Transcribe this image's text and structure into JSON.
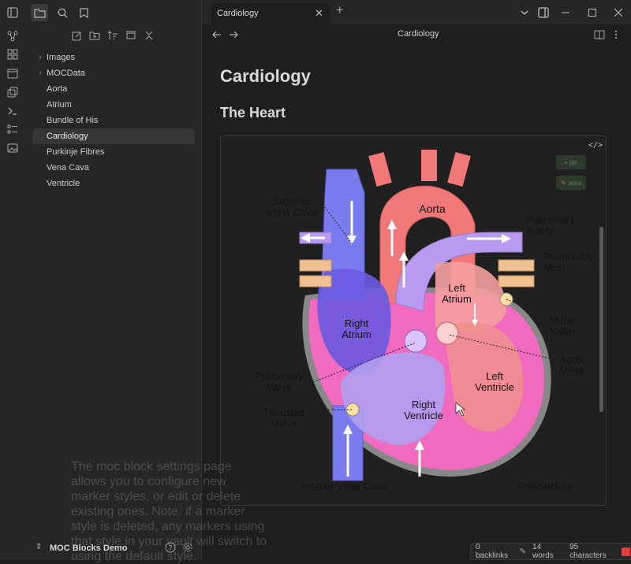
{
  "tab": {
    "title": "Cardiology"
  },
  "view_header": {
    "title": "Cardiology"
  },
  "sidebar": {
    "files": [
      {
        "label": "Images",
        "folder": true
      },
      {
        "label": "MOCData",
        "folder": true
      },
      {
        "label": "Aorta"
      },
      {
        "label": "Atrium"
      },
      {
        "label": "Bundle of His"
      },
      {
        "label": "Cardiology",
        "active": true
      },
      {
        "label": "Purkinje Fibres"
      },
      {
        "label": "Vena Cava"
      },
      {
        "label": "Ventricle"
      }
    ],
    "vault_name": "MOC Blocks Demo"
  },
  "note": {
    "title": "Cardiology",
    "heading": "The Heart",
    "overlay_text": "The moc block settings page allows you to configure new marker styles, or edit or delete existing ones. Note: if a marker style is deleted, any markers using that style in your vault will switch to using the default style."
  },
  "moc_block": {
    "markers": [
      "+ pin",
      "area"
    ],
    "code_icon": "</>"
  },
  "diagram_labels": {
    "superior_vena_cava": [
      "Superior",
      "Vena Cava"
    ],
    "aorta": "Aorta",
    "pulmonary_artery": [
      "Pulmonary",
      "Artery"
    ],
    "pulmonary_vein": [
      "Pulmonary",
      "Vein"
    ],
    "left_atrium": [
      "Left",
      "Atrium"
    ],
    "right_atrium": [
      "Right",
      "Atrium"
    ],
    "mitral_valve": [
      "Mitral",
      "Valve"
    ],
    "aortic_valve": [
      "Aortic",
      "Valve"
    ],
    "pulmonary_valve": [
      "Pulmonary",
      "Valve"
    ],
    "left_ventricle": [
      "Left",
      "Ventricle"
    ],
    "right_ventricle": [
      "Right",
      "Ventricle"
    ],
    "tricuspid_valve": [
      "Tricuspid",
      "Valve"
    ],
    "inferior_vena_cava": "Inferior Vena Cava",
    "pericardium": "Pericardium"
  },
  "status": {
    "backlinks": "0 backlinks",
    "words": "14 words",
    "characters": "95 characters"
  },
  "colors": {
    "bg": "#1e1e1e",
    "panel": "#262626",
    "active_item": "#363636",
    "vein_blue": "#7b7bf0",
    "artery_red": "#f07878",
    "pulmonary_purple": "#b89af0",
    "heart_pink": "#f06ac0"
  }
}
